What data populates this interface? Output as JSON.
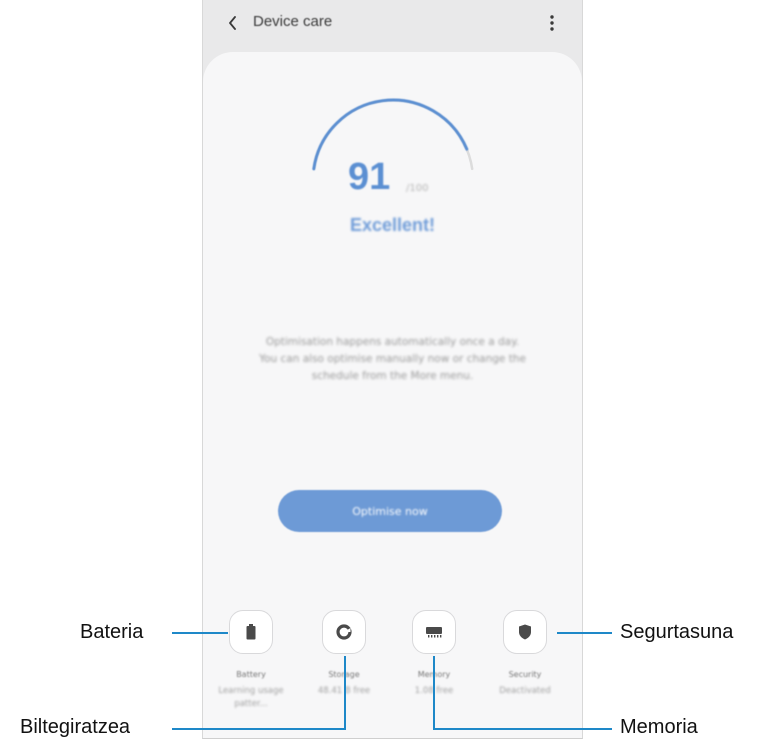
{
  "appbar": {
    "title": "Device care",
    "back_icon": "chevron-left-icon",
    "more_icon": "more-vertical-icon"
  },
  "score": {
    "value": "91",
    "max": "/100",
    "fraction": 0.91,
    "status": "Excellent!",
    "accent_color": "#5b8fd2"
  },
  "description": [
    "Optimisation happens automatically once a day.",
    "You can also optimise manually now or change the",
    "schedule from the More menu."
  ],
  "optimise_button": {
    "label": "Optimise now",
    "color": "#6d9ad6"
  },
  "tiles": [
    {
      "icon": "battery-icon",
      "label": "Battery",
      "status": "Learning usage patter..."
    },
    {
      "icon": "storage-icon",
      "label": "Storage",
      "status": "48.41 B free"
    },
    {
      "icon": "memory-icon",
      "label": "Memory",
      "status": "1.08 free"
    },
    {
      "icon": "security-icon",
      "label": "Security",
      "status": "Deactivated"
    }
  ],
  "callouts": {
    "battery": "Bateria",
    "storage": "Biltegiratzea",
    "memory": "Memoria",
    "security": "Segurtasuna"
  }
}
